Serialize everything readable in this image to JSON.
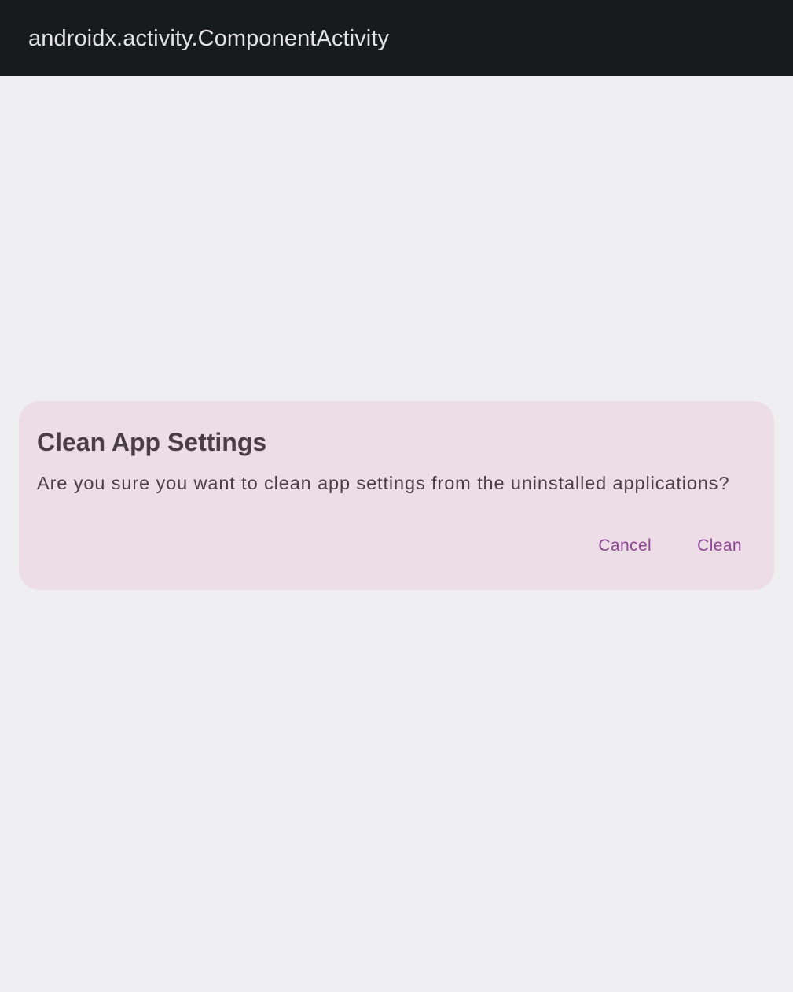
{
  "app_bar": {
    "title": "androidx.activity.ComponentActivity"
  },
  "dialog": {
    "title": "Clean App Settings",
    "message": "Are you sure you want to clean app settings from the uninstalled applications?",
    "cancel_label": "Cancel",
    "confirm_label": "Clean"
  },
  "colors": {
    "app_bar_bg": "#181b1e",
    "background": "#efeff2",
    "dialog_bg": "#eddde6",
    "dialog_text": "#4c3e47",
    "accent": "#8e4595"
  }
}
